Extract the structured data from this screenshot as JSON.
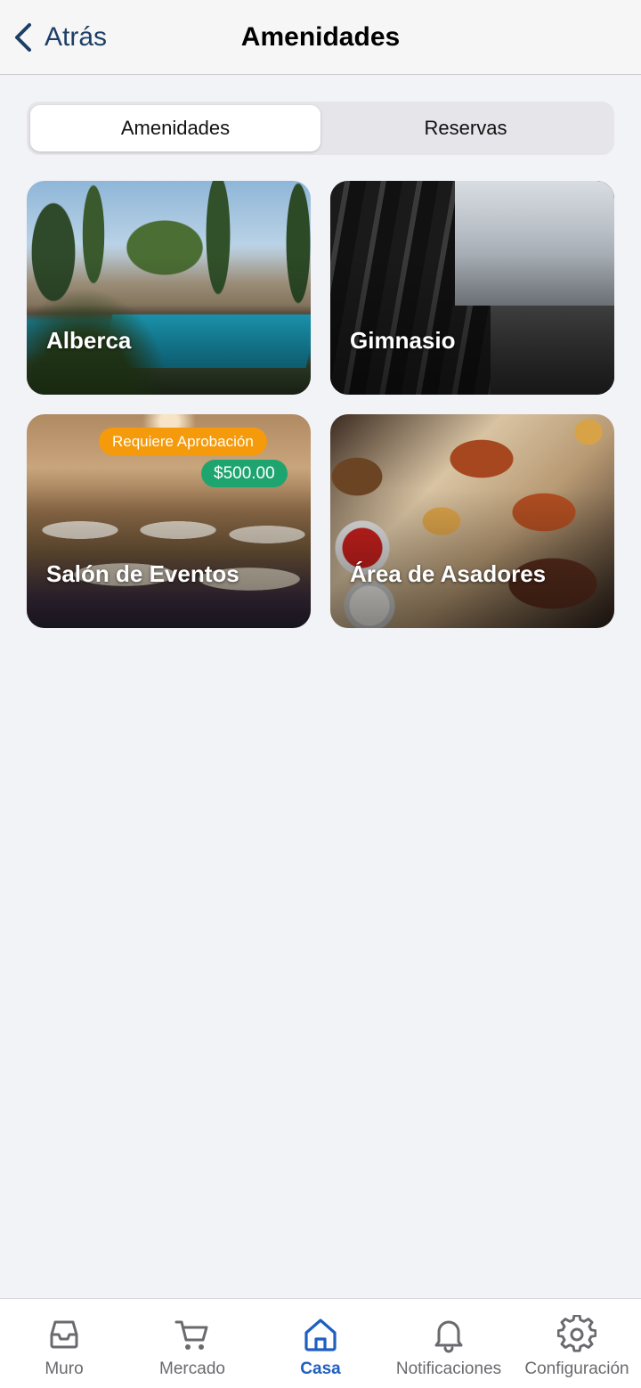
{
  "header": {
    "back_label": "Atrás",
    "title": "Amenidades"
  },
  "segmented": {
    "items": [
      {
        "label": "Amenidades",
        "active": true
      },
      {
        "label": "Reservas",
        "active": false
      }
    ]
  },
  "amenities": [
    {
      "title": "Alberca"
    },
    {
      "title": "Gimnasio"
    },
    {
      "title": "Salón de Eventos",
      "badge_approval": "Requiere Aprobación",
      "price": "$500.00"
    },
    {
      "title": "Área de Asadores"
    }
  ],
  "tabbar": {
    "items": [
      {
        "label": "Muro",
        "icon": "inbox-icon"
      },
      {
        "label": "Mercado",
        "icon": "cart-icon"
      },
      {
        "label": "Casa",
        "icon": "home-icon",
        "active": true
      },
      {
        "label": "Notificaciones",
        "icon": "bell-icon"
      },
      {
        "label": "Configuración",
        "icon": "gear-icon"
      }
    ]
  },
  "colors": {
    "accent": "#1f5fbf",
    "back_text": "#1d3f66",
    "approval_badge": "#f59a0b",
    "price_badge": "#1ea56f",
    "background": "#f2f3f7"
  }
}
